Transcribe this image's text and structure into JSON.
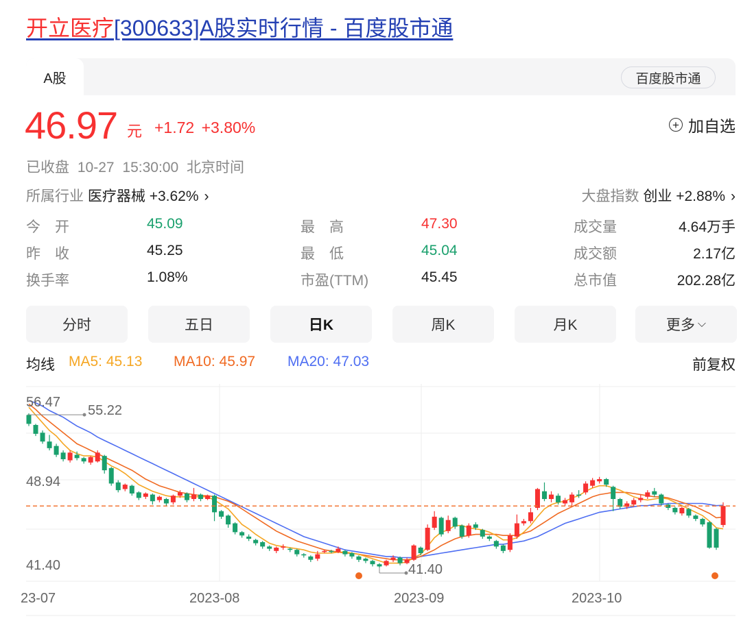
{
  "page": {
    "title_highlight": "开立医疗",
    "title_rest": "[300633]A股实时行情 - 百度股市通"
  },
  "tabs": {
    "active": "A股",
    "badge": "百度股市通"
  },
  "quote": {
    "price": "46.97",
    "unit": "元",
    "change": "+1.72 +3.80%",
    "follow_label": "加自选",
    "status": "已收盘",
    "time": "10-27 15:30:00",
    "timezone": "北京时间",
    "industry_label": "所属行业",
    "industry_name": "医疗器械",
    "industry_change": "+3.62%",
    "index_label": "大盘指数",
    "index_name": "创业",
    "index_change": "+2.88%"
  },
  "stats": [
    [
      {
        "label": "今　开",
        "value": "45.09",
        "color": "down"
      },
      {
        "label": "最　高",
        "value": "47.30",
        "color": "up"
      },
      {
        "label": "成交量",
        "value": "4.64万手",
        "color": "neutral"
      }
    ],
    [
      {
        "label": "昨　收",
        "value": "45.25",
        "color": "neutral"
      },
      {
        "label": "最　低",
        "value": "45.04",
        "color": "down"
      },
      {
        "label": "成交额",
        "value": "2.17亿",
        "color": "neutral"
      }
    ],
    [
      {
        "label": "换手率",
        "value": "1.08%",
        "color": "neutral"
      },
      {
        "label": "市盈(TTM)",
        "value": "45.45",
        "color": "neutral"
      },
      {
        "label": "总市值",
        "value": "202.28亿",
        "color": "neutral"
      }
    ]
  ],
  "period_tabs": [
    "分时",
    "五日",
    "日K",
    "周K",
    "月K",
    "更多"
  ],
  "active_period": "日K",
  "ma": {
    "label": "均线",
    "ma5": "MA5: 45.13",
    "ma10": "MA10: 45.97",
    "ma20": "MA20: 47.03",
    "adjust": "前复权"
  },
  "chart_data": {
    "type": "candlestick",
    "y_ticks": [
      "56.47",
      "48.94",
      "41.40"
    ],
    "x_ticks": [
      "23-07",
      "2023-08",
      "2023-09",
      "2023-10"
    ],
    "annotations": {
      "high_label": "55.22",
      "low_label": "41.40"
    },
    "last_close_line": 46.97,
    "ylim": [
      41.4,
      56.47
    ],
    "colors": {
      "up": "#f73131",
      "down": "#1aa06d",
      "ma5": "#f5a623",
      "ma10": "#f06a22",
      "ma20": "#4e6ef2"
    },
    "candles": [
      [
        55.2,
        54.4,
        55.35,
        54.2
      ],
      [
        54.3,
        53.5,
        54.4,
        53.3
      ],
      [
        53.6,
        52.8,
        53.8,
        52.6
      ],
      [
        52.8,
        52.2,
        53.4,
        52.0
      ],
      [
        52.4,
        51.6,
        52.6,
        51.4
      ],
      [
        51.8,
        51.2,
        52.0,
        51.0
      ],
      [
        51.1,
        51.8,
        52.0,
        50.9
      ],
      [
        51.6,
        51.3,
        51.9,
        51.1
      ],
      [
        51.3,
        51.0,
        51.4,
        50.8
      ],
      [
        50.9,
        51.4,
        51.5,
        50.7
      ],
      [
        51.0,
        51.8,
        52.0,
        50.9
      ],
      [
        51.5,
        50.2,
        51.6,
        49.9
      ],
      [
        50.4,
        49.0,
        50.5,
        48.8
      ],
      [
        49.1,
        48.4,
        49.3,
        48.2
      ],
      [
        48.5,
        48.9,
        49.0,
        48.3
      ],
      [
        48.8,
        48.1,
        48.9,
        47.9
      ],
      [
        48.2,
        47.7,
        48.3,
        47.5
      ],
      [
        47.8,
        48.1,
        48.2,
        47.6
      ],
      [
        48.0,
        47.4,
        48.1,
        47.1
      ],
      [
        47.5,
        47.8,
        47.9,
        47.3
      ],
      [
        47.6,
        47.2,
        47.7,
        47.0
      ],
      [
        47.3,
        47.9,
        48.0,
        47.1
      ],
      [
        47.9,
        48.2,
        48.4,
        47.7
      ],
      [
        48.1,
        47.5,
        48.2,
        47.3
      ],
      [
        47.6,
        48.0,
        48.6,
        47.4
      ],
      [
        48.0,
        47.6,
        48.1,
        47.4
      ],
      [
        47.6,
        47.9,
        48.0,
        47.5
      ],
      [
        47.9,
        46.4,
        48.0,
        45.6
      ],
      [
        46.5,
        46.0,
        46.6,
        45.8
      ],
      [
        46.1,
        45.3,
        46.2,
        45.0
      ],
      [
        45.4,
        44.6,
        45.5,
        44.4
      ],
      [
        44.6,
        44.3,
        44.7,
        44.1
      ],
      [
        44.2,
        44.0,
        44.4,
        43.8
      ],
      [
        43.9,
        43.6,
        44.0,
        43.4
      ],
      [
        43.7,
        43.3,
        43.8,
        43.1
      ],
      [
        43.3,
        43.1,
        43.4,
        42.9
      ],
      [
        42.9,
        43.2,
        43.3,
        42.7
      ],
      [
        43.2,
        43.3,
        43.5,
        43.0
      ],
      [
        43.1,
        43.0,
        43.2,
        42.8
      ],
      [
        43.0,
        42.6,
        43.1,
        42.4
      ],
      [
        42.6,
        42.5,
        42.7,
        42.3
      ],
      [
        42.4,
        42.1,
        42.5,
        41.9
      ],
      [
        42.2,
        42.6,
        42.9,
        42.0
      ],
      [
        42.9,
        42.9,
        43.0,
        42.7
      ],
      [
        42.9,
        42.8,
        43.0,
        42.7
      ],
      [
        42.8,
        43.1,
        43.3,
        42.7
      ],
      [
        42.9,
        42.6,
        43.0,
        42.4
      ],
      [
        42.7,
        42.4,
        42.8,
        42.2
      ],
      [
        42.4,
        42.1,
        42.5,
        41.9
      ],
      [
        42.2,
        42.0,
        42.3,
        41.8
      ],
      [
        42.0,
        41.7,
        42.1,
        41.5
      ],
      [
        41.7,
        41.5,
        41.8,
        41.4
      ],
      [
        41.6,
        42.0,
        42.1,
        41.5
      ],
      [
        42.1,
        42.3,
        42.5,
        41.9
      ],
      [
        42.3,
        41.8,
        42.4,
        41.6
      ],
      [
        41.8,
        42.1,
        42.3,
        41.7
      ],
      [
        42.1,
        43.4,
        43.5,
        42.0
      ],
      [
        43.2,
        42.7,
        43.3,
        42.5
      ],
      [
        43.0,
        45.0,
        45.3,
        42.9
      ],
      [
        45.0,
        46.0,
        46.5,
        44.8
      ],
      [
        45.9,
        44.4,
        46.0,
        44.2
      ],
      [
        44.7,
        45.7,
        46.1,
        44.5
      ],
      [
        45.9,
        45.1,
        46.0,
        44.9
      ],
      [
        45.2,
        44.2,
        45.3,
        44.0
      ],
      [
        44.3,
        45.2,
        45.4,
        44.1
      ],
      [
        45.3,
        45.0,
        45.5,
        44.8
      ],
      [
        44.8,
        44.2,
        44.9,
        44.0
      ],
      [
        44.2,
        44.0,
        44.3,
        43.8
      ],
      [
        43.8,
        43.3,
        43.9,
        43.1
      ],
      [
        43.4,
        42.9,
        43.5,
        42.7
      ],
      [
        43.0,
        44.3,
        44.5,
        42.8
      ],
      [
        44.2,
        45.4,
        46.2,
        44.0
      ],
      [
        45.4,
        45.6,
        45.8,
        45.2
      ],
      [
        45.6,
        46.4,
        46.8,
        45.4
      ],
      [
        46.8,
        48.5,
        48.6,
        46.6
      ],
      [
        48.3,
        47.6,
        49.1,
        47.4
      ],
      [
        47.6,
        48.0,
        48.3,
        47.3
      ],
      [
        47.9,
        47.3,
        48.1,
        47.1
      ],
      [
        47.2,
        47.5,
        47.7,
        47.0
      ],
      [
        47.3,
        48.0,
        48.2,
        47.0
      ],
      [
        48.0,
        47.9,
        48.4,
        47.7
      ],
      [
        48.2,
        49.0,
        49.2,
        48.0
      ],
      [
        48.8,
        49.3,
        49.5,
        48.6
      ],
      [
        49.2,
        49.4,
        49.6,
        49.0
      ],
      [
        49.4,
        48.9,
        49.5,
        48.7
      ],
      [
        48.7,
        47.6,
        48.8,
        46.5
      ],
      [
        47.6,
        46.9,
        47.7,
        46.7
      ],
      [
        46.9,
        47.2,
        47.4,
        46.7
      ],
      [
        47.1,
        47.5,
        47.7,
        46.9
      ],
      [
        47.5,
        47.7,
        48.0,
        47.3
      ],
      [
        47.8,
        48.2,
        48.4,
        47.6
      ],
      [
        48.3,
        48.0,
        48.6,
        47.8
      ],
      [
        48.0,
        47.2,
        48.1,
        47.0
      ],
      [
        47.1,
        46.8,
        47.2,
        46.6
      ],
      [
        46.8,
        46.4,
        46.9,
        46.2
      ],
      [
        46.3,
        46.8,
        46.9,
        46.1
      ],
      [
        46.7,
        46.1,
        46.8,
        45.9
      ],
      [
        46.1,
        45.8,
        46.2,
        45.6
      ],
      [
        45.8,
        45.3,
        45.9,
        45.1
      ],
      [
        45.5,
        43.2,
        45.6,
        43.1
      ],
      [
        44.9,
        43.2,
        45.0,
        43.0
      ],
      [
        45.25,
        46.97,
        47.3,
        45.04
      ]
    ],
    "ma5": [
      55.9,
      55.2,
      54.5,
      53.8,
      53.3,
      52.6,
      52.0,
      51.7,
      51.5,
      51.5,
      51.4,
      51.0,
      50.6,
      50.3,
      49.9,
      49.4,
      48.9,
      48.6,
      48.3,
      48.1,
      47.9,
      47.8,
      47.8,
      47.8,
      47.8,
      47.8,
      47.8,
      47.5,
      47.1,
      46.7,
      46.0,
      45.3,
      44.9,
      44.4,
      44.0,
      43.6,
      43.4,
      43.3,
      43.2,
      43.1,
      43.0,
      42.8,
      42.7,
      42.7,
      42.7,
      42.8,
      42.8,
      42.7,
      42.6,
      42.4,
      42.2,
      42.0,
      41.8,
      41.8,
      41.8,
      41.9,
      42.3,
      42.6,
      43.3,
      44.1,
      44.6,
      44.8,
      45.2,
      45.2,
      45.0,
      44.9,
      44.8,
      44.6,
      44.3,
      43.9,
      43.9,
      44.1,
      44.6,
      45.2,
      46.0,
      46.7,
      47.1,
      47.3,
      47.4,
      47.7,
      47.9,
      48.3,
      48.6,
      48.8,
      48.8,
      48.6,
      48.4,
      48.1,
      47.8,
      47.6,
      47.5,
      47.6,
      47.7,
      47.6,
      47.3,
      47.0,
      46.7,
      46.4,
      46.1,
      45.6,
      45.0,
      44.9
    ],
    "ma10": [
      56.2,
      55.7,
      55.1,
      54.6,
      54.1,
      53.6,
      53.1,
      52.6,
      52.3,
      52.0,
      51.7,
      51.4,
      51.1,
      50.8,
      50.5,
      50.2,
      49.8,
      49.4,
      49.1,
      48.8,
      48.6,
      48.4,
      48.2,
      48.1,
      48.0,
      47.9,
      47.9,
      47.8,
      47.6,
      47.4,
      47.1,
      46.7,
      46.3,
      45.9,
      45.5,
      45.1,
      44.7,
      44.4,
      44.1,
      43.8,
      43.6,
      43.4,
      43.2,
      43.0,
      42.9,
      42.8,
      42.7,
      42.7,
      42.6,
      42.5,
      42.4,
      42.3,
      42.2,
      42.1,
      42.1,
      42.1,
      42.2,
      42.4,
      42.7,
      43.0,
      43.4,
      43.7,
      44.0,
      44.2,
      44.3,
      44.4,
      44.4,
      44.4,
      44.4,
      44.3,
      44.3,
      44.3,
      44.5,
      44.7,
      45.1,
      45.5,
      45.9,
      46.3,
      46.6,
      46.9,
      47.2,
      47.5,
      47.8,
      48.0,
      48.1,
      48.2,
      48.2,
      48.2,
      48.1,
      48.0,
      47.9,
      47.8,
      47.8,
      47.7,
      47.5,
      47.3,
      47.1,
      46.9,
      46.6,
      46.3,
      45.9,
      45.97
    ],
    "ma20": [
      56.5,
      56.3,
      56.0,
      55.6,
      55.3,
      55.0,
      54.6,
      54.2,
      53.9,
      53.6,
      53.2,
      52.9,
      52.6,
      52.3,
      52.0,
      51.7,
      51.4,
      51.1,
      50.8,
      50.5,
      50.2,
      49.9,
      49.6,
      49.3,
      49.0,
      48.7,
      48.4,
      48.1,
      47.8,
      47.5,
      47.2,
      46.9,
      46.6,
      46.3,
      46.0,
      45.7,
      45.4,
      45.1,
      44.8,
      44.5,
      44.2,
      44.0,
      43.8,
      43.6,
      43.4,
      43.2,
      43.0,
      42.9,
      42.8,
      42.7,
      42.6,
      42.5,
      42.4,
      42.4,
      42.3,
      42.3,
      42.3,
      42.4,
      42.5,
      42.6,
      42.7,
      42.8,
      42.9,
      43.0,
      43.1,
      43.2,
      43.3,
      43.4,
      43.5,
      43.5,
      43.6,
      43.7,
      43.8,
      44.0,
      44.2,
      44.5,
      44.8,
      45.1,
      45.4,
      45.6,
      45.8,
      46.0,
      46.2,
      46.4,
      46.5,
      46.6,
      46.7,
      46.8,
      46.9,
      47.0,
      47.0,
      47.1,
      47.1,
      47.2,
      47.2,
      47.2,
      47.2,
      47.2,
      47.2,
      47.1,
      47.0,
      47.03
    ]
  }
}
